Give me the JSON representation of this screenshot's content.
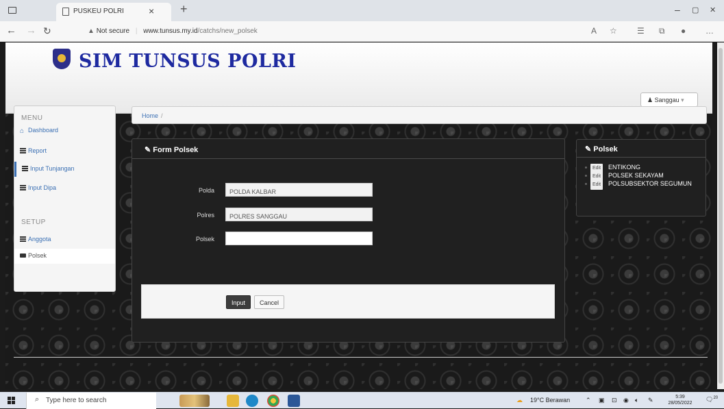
{
  "browser": {
    "tab_title": "PUSKEU POLRI",
    "tab_close": "×",
    "new_tab": "+",
    "not_secure": "Not secure",
    "url_host": "www.tunsus.my.id",
    "url_path": "/catchs/new_polsek",
    "minimize": "–",
    "restore": "▢",
    "close": "✕"
  },
  "header": {
    "brand": "SIM TUNSUS POLRI",
    "user_menu": "Sanggau"
  },
  "sidebar": {
    "menu_heading": "MENU",
    "setup_heading": "SETUP",
    "items": [
      {
        "label": "Dashboard"
      },
      {
        "label": "Report"
      },
      {
        "label": "Input Tunjangan"
      },
      {
        "label": "Input Dipa"
      },
      {
        "label": "Anggota"
      },
      {
        "label": "Polsek"
      }
    ]
  },
  "breadcrumb": {
    "home": "Home",
    "sep": "/"
  },
  "form": {
    "title": "Form Polsek",
    "polda_label": "Polda",
    "polda_value": "POLDA KALBAR",
    "polres_label": "Polres",
    "polres_value": "POLRES SANGGAU",
    "polsek_label": "Polsek",
    "polsek_value": "",
    "input_button": "Input",
    "cancel_button": "Cancel"
  },
  "polsek_panel": {
    "title": "Polsek",
    "edit_label": "Edit",
    "items": [
      "ENTIKONG",
      "POLSEK SEKAYAM",
      "POLSUBSEKTOR SEGUMUN"
    ]
  },
  "taskbar": {
    "search_placeholder": "Type here to search",
    "weather": "19°C  Berawan",
    "time": "5:39",
    "date": "28/05/2022",
    "notifications": "20"
  }
}
